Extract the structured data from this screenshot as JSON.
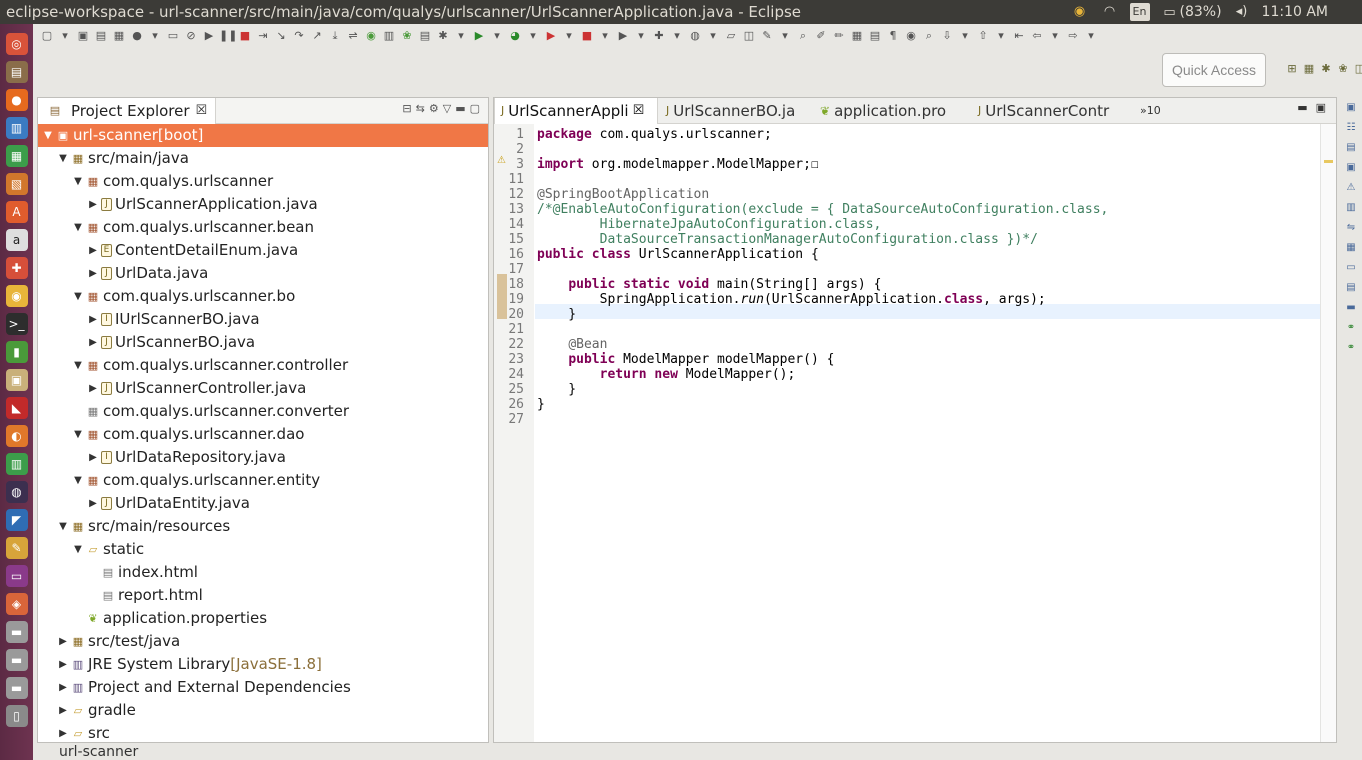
{
  "window": {
    "title": "eclipse-workspace - url-scanner/src/main/java/com/qualys/urlscanner/UrlScannerApplication.java - Eclipse"
  },
  "tray": {
    "language": "En",
    "battery": "(83%)",
    "time": "11:10 AM"
  },
  "quick_access": {
    "label": "Quick Access"
  },
  "project_explorer": {
    "tab_label": "Project Explorer",
    "rows": [
      {
        "text": "url-scanner",
        "suffix": " [boot]"
      },
      {
        "text": "src/main/java"
      },
      {
        "text": "com.qualys.urlscanner"
      },
      {
        "text": "UrlScannerApplication.java"
      },
      {
        "text": "com.qualys.urlscanner.bean"
      },
      {
        "text": "ContentDetailEnum.java"
      },
      {
        "text": "UrlData.java"
      },
      {
        "text": "com.qualys.urlscanner.bo"
      },
      {
        "text": "IUrlScannerBO.java"
      },
      {
        "text": "UrlScannerBO.java"
      },
      {
        "text": "com.qualys.urlscanner.controller"
      },
      {
        "text": "UrlScannerController.java"
      },
      {
        "text": "com.qualys.urlscanner.converter"
      },
      {
        "text": "com.qualys.urlscanner.dao"
      },
      {
        "text": "UrlDataRepository.java"
      },
      {
        "text": "com.qualys.urlscanner.entity"
      },
      {
        "text": "UrlDataEntity.java"
      },
      {
        "text": "src/main/resources"
      },
      {
        "text": "static"
      },
      {
        "text": "index.html"
      },
      {
        "text": "report.html"
      },
      {
        "text": "application.properties"
      },
      {
        "text": "src/test/java"
      },
      {
        "text": "JRE System Library",
        "suffix": " [JavaSE-1.8]"
      },
      {
        "text": "Project and External Dependencies"
      },
      {
        "text": "gradle"
      },
      {
        "text": "src"
      }
    ]
  },
  "editor": {
    "tabs": [
      {
        "label": "UrlScannerAppli"
      },
      {
        "label": "UrlScannerBO.ja"
      },
      {
        "label": "application.pro"
      },
      {
        "label": "UrlScannerContr"
      }
    ],
    "overflow_count": "»10",
    "line_numbers": [
      "1",
      "2",
      "3",
      "11",
      "12",
      "13",
      "14",
      "15",
      "16",
      "17",
      "18",
      "19",
      "20",
      "21",
      "22",
      "23",
      "24",
      "25",
      "26",
      "27"
    ],
    "lines": [
      [
        {
          "t": "package",
          "c": "kw"
        },
        {
          "t": " com.qualys.urlscanner;"
        }
      ],
      [],
      [
        {
          "t": "import",
          "c": "kw"
        },
        {
          "t": " org.modelmapper.ModelMapper;"
        },
        {
          "t": "☐"
        }
      ],
      [],
      [
        {
          "t": "@SpringBootApplication",
          "c": "an"
        }
      ],
      [
        {
          "t": "/*@EnableAutoConfiguration(exclude = { DataSourceAutoConfiguration.class,",
          "c": "cm"
        }
      ],
      [
        {
          "t": "        HibernateJpaAutoConfiguration.class,",
          "c": "cm"
        }
      ],
      [
        {
          "t": "        DataSourceTransactionManagerAutoConfiguration.class })*/",
          "c": "cm"
        }
      ],
      [
        {
          "t": "public",
          "c": "kw"
        },
        {
          "t": " "
        },
        {
          "t": "class",
          "c": "kw"
        },
        {
          "t": " UrlScannerApplication {"
        }
      ],
      [],
      [
        {
          "t": "    "
        },
        {
          "t": "public",
          "c": "kw"
        },
        {
          "t": " "
        },
        {
          "t": "static",
          "c": "kw"
        },
        {
          "t": " "
        },
        {
          "t": "void",
          "c": "kw"
        },
        {
          "t": " main(String[] args) {"
        }
      ],
      [
        {
          "t": "        SpringApplication."
        },
        {
          "t": "run",
          "c": "it"
        },
        {
          "t": "(UrlScannerApplication."
        },
        {
          "t": "class",
          "c": "kw"
        },
        {
          "t": ", args);"
        }
      ],
      [
        {
          "t": "    }"
        }
      ],
      [],
      [
        {
          "t": "    "
        },
        {
          "t": "@Bean",
          "c": "an"
        }
      ],
      [
        {
          "t": "    "
        },
        {
          "t": "public",
          "c": "kw"
        },
        {
          "t": " ModelMapper modelMapper() {"
        }
      ],
      [
        {
          "t": "        "
        },
        {
          "t": "return",
          "c": "kw"
        },
        {
          "t": " "
        },
        {
          "t": "new",
          "c": "kw"
        },
        {
          "t": " ModelMapper();"
        }
      ],
      [
        {
          "t": "    }"
        }
      ],
      [
        {
          "t": "}"
        }
      ],
      []
    ]
  },
  "status_bar": {
    "text": "url-scanner"
  }
}
